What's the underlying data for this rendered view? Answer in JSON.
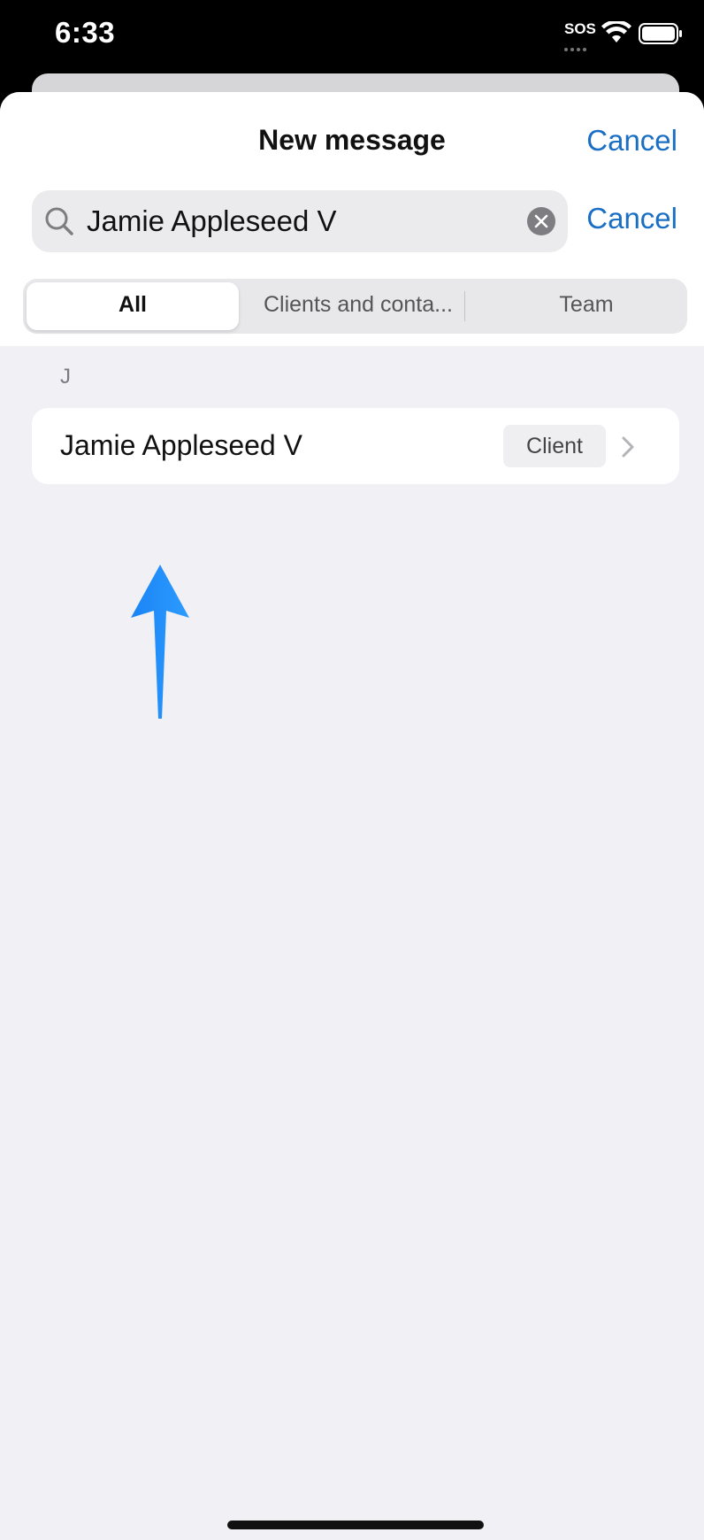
{
  "status_bar": {
    "time": "6:33",
    "sos": "SOS"
  },
  "header": {
    "title": "New message",
    "cancel_label": "Cancel"
  },
  "search": {
    "value": "Jamie Appleseed V",
    "cancel_label": "Cancel"
  },
  "segments": [
    {
      "label": "All",
      "selected": true
    },
    {
      "label": "Clients and conta...",
      "selected": false
    },
    {
      "label": "Team",
      "selected": false
    }
  ],
  "results": {
    "section_letter": "J",
    "items": [
      {
        "name": "Jamie Appleseed V",
        "badge": "Client"
      }
    ]
  },
  "colors": {
    "accent": "#1a6fc4",
    "annotation_arrow": "#1f8fff",
    "background": "#f0f0f5"
  },
  "icons": {
    "search": "magnifying-glass-icon",
    "clear": "clear-x-icon",
    "chevron": "chevron-right-icon",
    "annotation": "up-arrow-annotation"
  }
}
